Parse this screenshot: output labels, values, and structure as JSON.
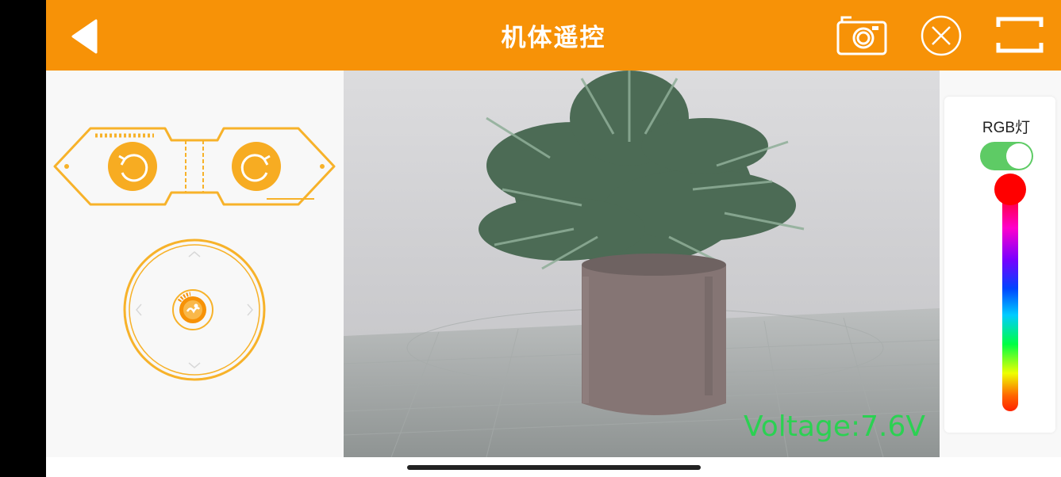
{
  "app": {
    "title": "机体遥控",
    "theme_color": "#f79207"
  },
  "header": {
    "back": {
      "icon": "back-arrow-icon"
    },
    "actions": [
      {
        "name": "camera",
        "icon": "camera-icon"
      },
      {
        "name": "close",
        "icon": "close-circle-icon"
      },
      {
        "name": "fullscreen",
        "icon": "fullscreen-icon"
      }
    ]
  },
  "controls": {
    "rotate_left": {
      "icon": "rotate-counterclockwise-icon"
    },
    "rotate_right": {
      "icon": "rotate-clockwise-icon"
    },
    "joystick": {
      "icon": "joystick-knob-icon"
    }
  },
  "video": {
    "voltage_text": "Voltage:7.6V",
    "overlay_color": "#2bd152"
  },
  "rgb": {
    "label": "RGB灯",
    "enabled": true,
    "toggle_color": "#5ecb65",
    "slider_value_color": "#ff0000"
  }
}
